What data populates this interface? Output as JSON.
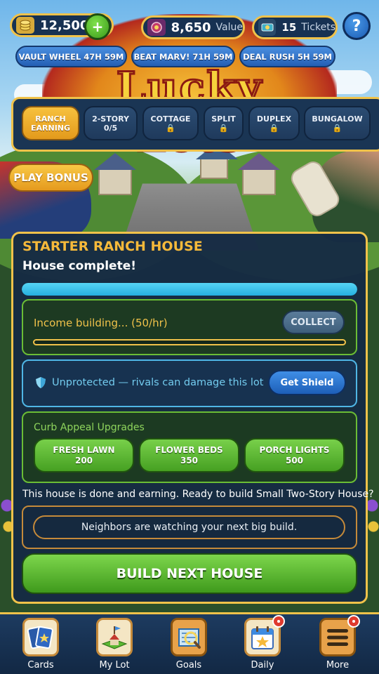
{
  "resources": {
    "coins": {
      "value": "12,500",
      "icon": "coin-stack-icon"
    },
    "value": {
      "value": "8,650",
      "unit": "Value",
      "icon": "vault-icon"
    },
    "tickets": {
      "value": "15",
      "unit": "Tickets",
      "icon": "ticket-icon"
    },
    "plus_label": "+",
    "help_label": "?"
  },
  "timers": [
    {
      "label": "VAULT WHEEL 47H 59M"
    },
    {
      "label": "BEAT MARV! 71H 59M"
    },
    {
      "label": "DEAL RUSH 5H 59M"
    }
  ],
  "logo_text": "Lucky Lots",
  "categories": [
    {
      "line1": "RANCH",
      "line2": "EARNING",
      "active": true
    },
    {
      "line1": "2-STORY",
      "line2": "0/5",
      "active": false
    },
    {
      "line1": "COTTAGE",
      "locked": true
    },
    {
      "line1": "SPLIT",
      "locked": true
    },
    {
      "line1": "DUPLEX",
      "locked": true
    },
    {
      "line1": "BUNGALOW",
      "locked": true
    }
  ],
  "lock_glyph": "🔒",
  "play_bonus_label": "PLAY BONUS",
  "house": {
    "title": "STARTER RANCH HOUSE",
    "status": "House complete!",
    "build_progress": 1.0
  },
  "income": {
    "text": "Income building... (50/hr)",
    "collect_label": "COLLECT",
    "progress": 0.0
  },
  "shield": {
    "text": "Unprotected — rivals can damage this lot",
    "button_label": "Get Shield"
  },
  "curb": {
    "title": "Curb Appeal Upgrades",
    "upgrades": [
      {
        "name": "FRESH LAWN",
        "cost": "200"
      },
      {
        "name": "FLOWER BEDS",
        "cost": "350"
      },
      {
        "name": "PORCH LIGHTS",
        "cost": "500"
      }
    ]
  },
  "done_text": "This house is done and earning. Ready to build Small Two-Story House?",
  "neighbor_text": "Neighbors are watching your next big build.",
  "build_label": "BUILD NEXT HOUSE",
  "nav": [
    {
      "label": "Cards",
      "icon": "cards-icon",
      "badge": false
    },
    {
      "label": "My Lot",
      "icon": "my-lot-icon",
      "badge": false
    },
    {
      "label": "Goals",
      "icon": "goals-icon",
      "badge": false
    },
    {
      "label": "Daily",
      "icon": "daily-calendar-icon",
      "badge": true
    },
    {
      "label": "More",
      "icon": "menu-icon",
      "badge": true
    }
  ],
  "colors": {
    "accent_gold": "#f0c24a",
    "panel_navy": "#162b44",
    "button_green": "#5cb832",
    "button_blue": "#2d74cf",
    "progress_cyan": "#3cc4ee"
  }
}
